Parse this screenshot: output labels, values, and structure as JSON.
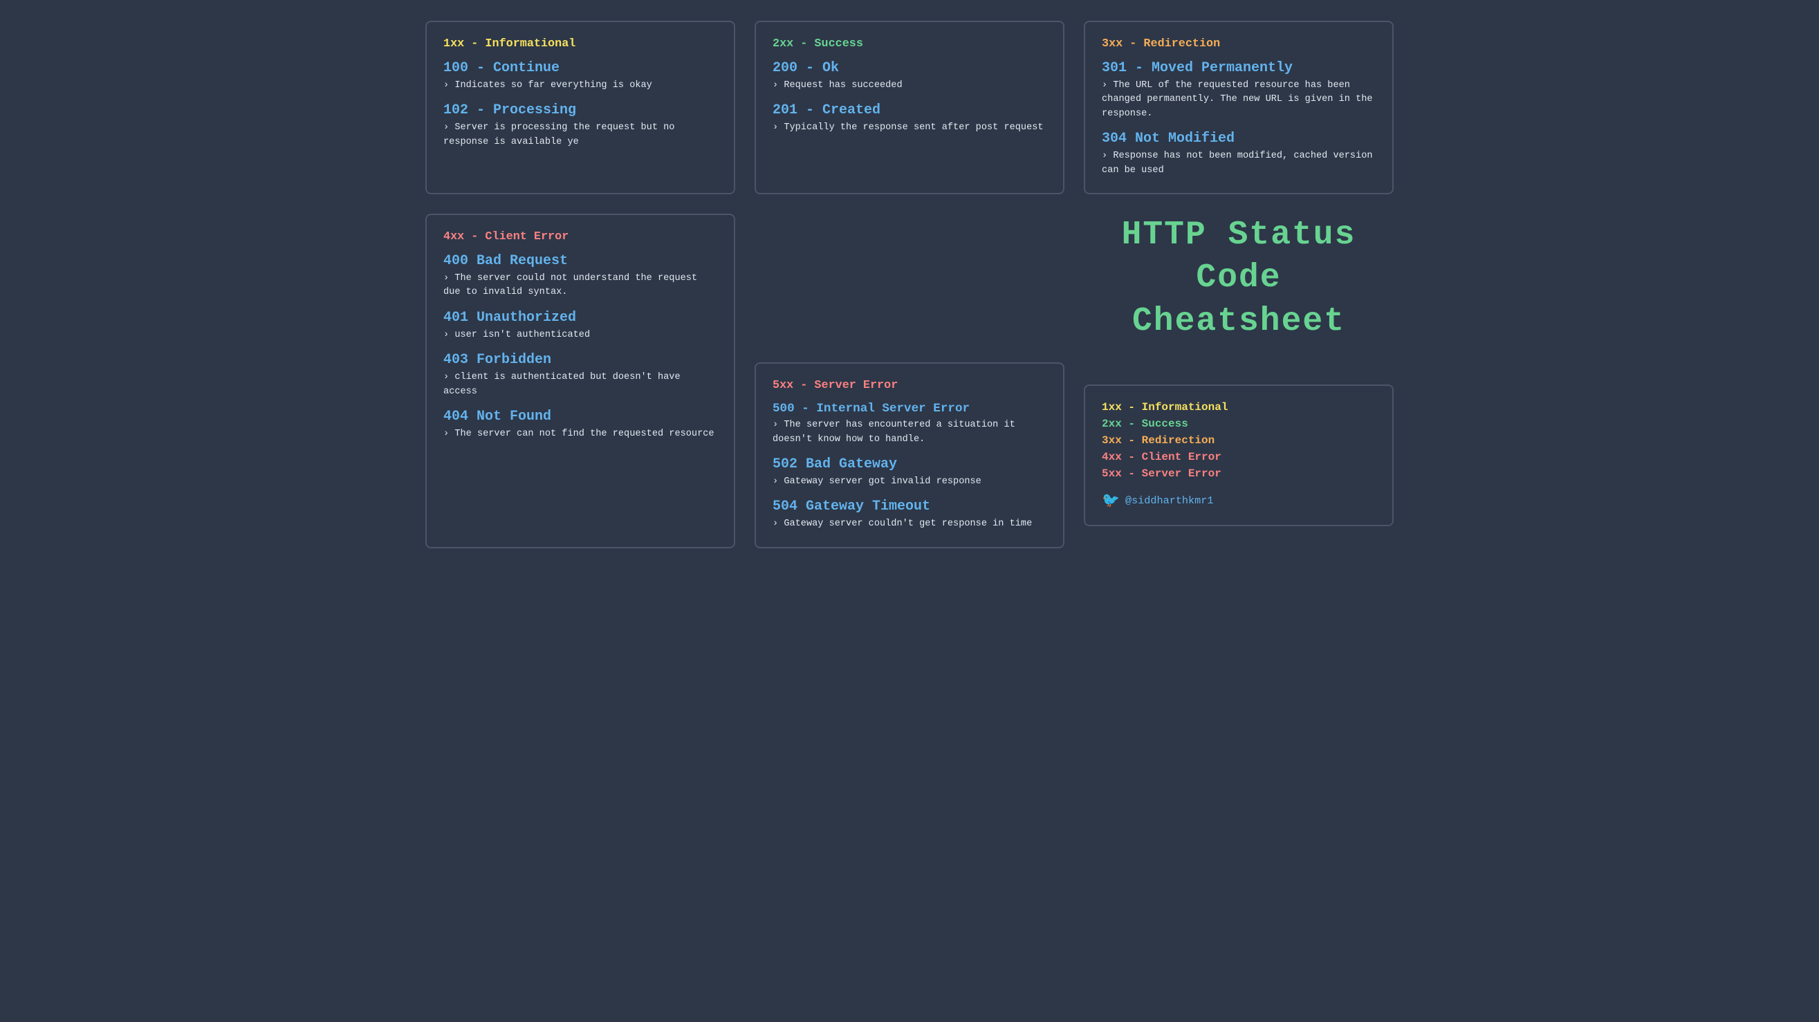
{
  "cards": {
    "1xx": {
      "category": "1xx - Informational",
      "codes": [
        {
          "code": "100 - Continue",
          "desc": "› Indicates so far everything is okay"
        },
        {
          "code": "102 - Processing",
          "desc": "› Server is processing the request but no response is available ye"
        }
      ]
    },
    "2xx": {
      "category": "2xx - Success",
      "codes": [
        {
          "code": "200 - Ok",
          "desc": "› Request has succeeded"
        },
        {
          "code": "201 - Created",
          "desc": "› Typically the response sent after post request"
        }
      ]
    },
    "3xx": {
      "category": "3xx - Redirection",
      "codes": [
        {
          "code": "301 - Moved Permanently",
          "desc": "› The URL of the requested resource has been changed permanently. The new URL is given in the response."
        },
        {
          "code": "304 Not Modified",
          "desc": "› Response has not been modified, cached version can be used"
        }
      ]
    },
    "4xx": {
      "category": "4xx - Client Error",
      "codes": [
        {
          "code": "400 Bad Request",
          "desc": "› The server could not understand the request due to invalid syntax."
        },
        {
          "code": "401 Unauthorized",
          "desc": "› user isn't authenticated"
        },
        {
          "code": "403 Forbidden",
          "desc": "› client is authenticated but doesn't have access"
        },
        {
          "code": "404 Not Found",
          "desc": "› The server can not find the requested resource"
        }
      ]
    },
    "5xx": {
      "category": "5xx - Server Error",
      "codes": [
        {
          "code": "500 - Internal Server Error",
          "desc": "› The server has encountered a situation it doesn't know how to handle."
        },
        {
          "code": "502 Bad Gateway",
          "desc": "› Gateway server got invalid response"
        },
        {
          "code": "504 Gateway Timeout",
          "desc": "› Gateway server couldn't get response in time"
        }
      ]
    }
  },
  "title": {
    "line1": "HTTP Status Code",
    "line2": "Cheatsheet"
  },
  "legend": {
    "items": [
      {
        "label": "1xx - Informational",
        "color_class": "color-1xx"
      },
      {
        "label": "2xx - Success",
        "color_class": "color-2xx"
      },
      {
        "label": "3xx - Redirection",
        "color_class": "color-3xx"
      },
      {
        "label": "4xx - Client Error",
        "color_class": "color-4xx"
      },
      {
        "label": "5xx - Server Error",
        "color_class": "color-5xx"
      }
    ],
    "twitter": "@siddharthkmr1"
  }
}
